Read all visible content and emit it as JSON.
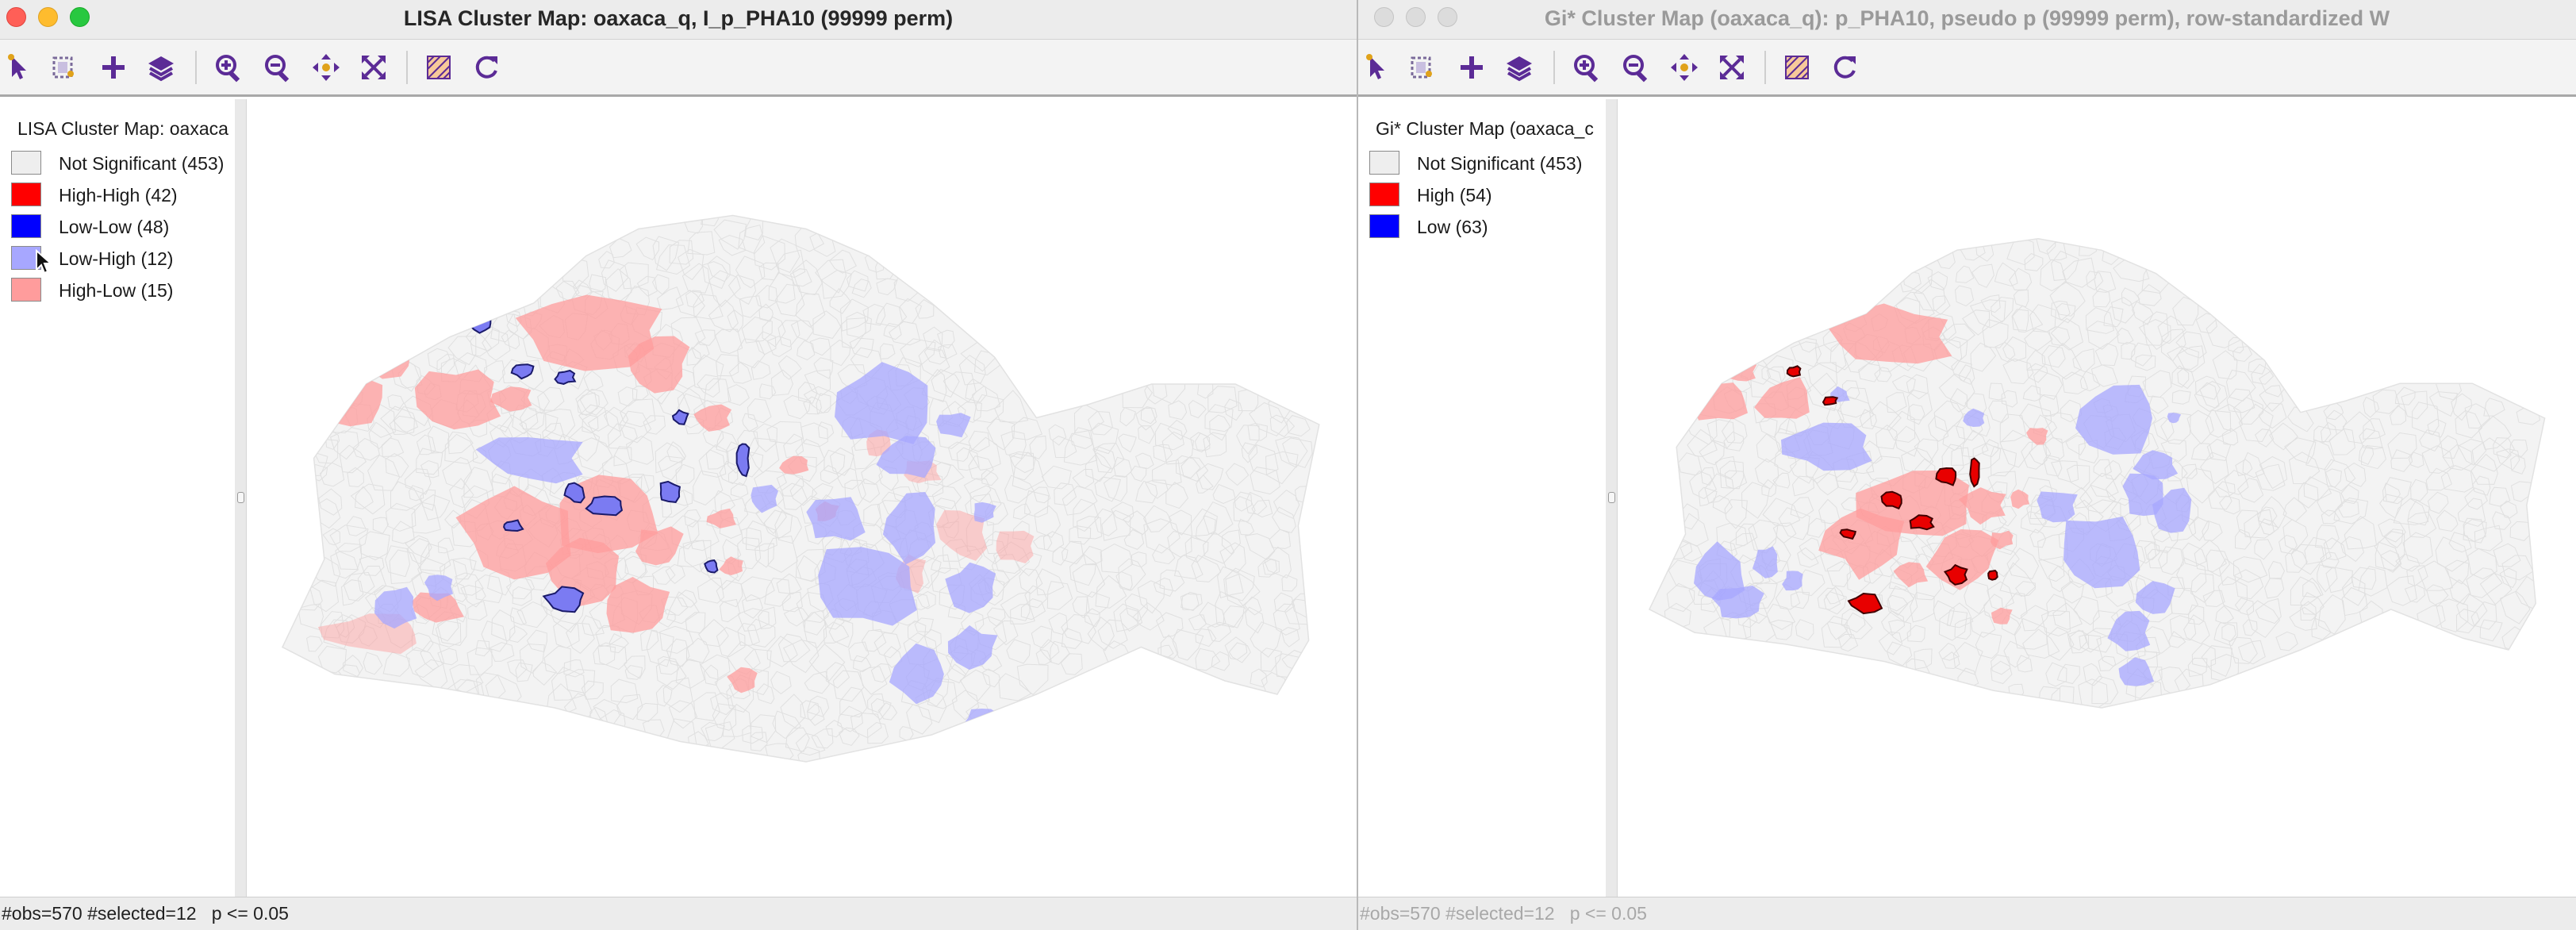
{
  "colors": {
    "not_significant": "#f3f3f3",
    "high_high": "#ff0000",
    "low_low": "#0000ff",
    "low_high": "#a7a7ff",
    "high_low": "#ff9c9c",
    "toolbar_icon": "#5b2b96",
    "toolbar_icon_accent": "#e0a21a"
  },
  "left_window": {
    "title": "LISA Cluster Map: oaxaca_q, I_p_PHA10 (99999 perm)",
    "toolbar": [
      "select-pointer-icon",
      "select-tool-icon",
      "add-icon",
      "layers-icon",
      "zoom-in-icon",
      "zoom-out-icon",
      "pan-icon",
      "fit-extent-icon",
      "map-toggle-icon",
      "refresh-icon"
    ],
    "legend": {
      "title": "LISA Cluster Map: oaxaca",
      "items": [
        {
          "label": "Not Significant (453)",
          "color": "#eeeeee"
        },
        {
          "label": "High-High (42)",
          "color": "#ff0000"
        },
        {
          "label": "Low-Low (48)",
          "color": "#0000ff"
        },
        {
          "label": "Low-High (12)",
          "color": "#a7a7ff"
        },
        {
          "label": "High-Low (15)",
          "color": "#ff9c9c"
        }
      ]
    },
    "status": "#obs=570 #selected=12   p <= 0.05"
  },
  "right_window": {
    "title": "Gi* Cluster Map (oaxaca_q): p_PHA10, pseudo p (99999 perm), row-standardized W",
    "toolbar": [
      "select-pointer-icon",
      "select-tool-icon",
      "add-icon",
      "layers-icon",
      "zoom-in-icon",
      "zoom-out-icon",
      "pan-icon",
      "fit-extent-icon",
      "map-toggle-icon",
      "refresh-icon"
    ],
    "legend": {
      "title": "Gi* Cluster Map (oaxaca_c",
      "items": [
        {
          "label": "Not Significant (453)",
          "color": "#eeeeee"
        },
        {
          "label": "High (54)",
          "color": "#ff0000"
        },
        {
          "label": "Low (63)",
          "color": "#0000ff"
        }
      ]
    },
    "status": "#obs=570 #selected=12   p <= 0.05"
  }
}
